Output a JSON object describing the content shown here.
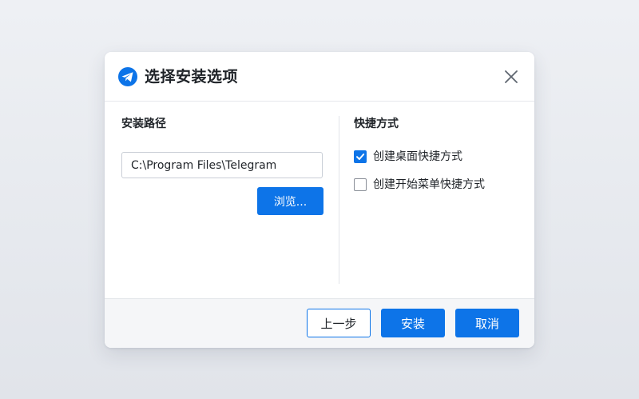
{
  "dialog": {
    "title": "选择安装选项",
    "logo_icon": "telegram-logo-icon",
    "close_icon": "close-icon"
  },
  "install_path": {
    "label": "安装路径",
    "value": "C:\\Program Files\\Telegram",
    "browse_label": "浏览..."
  },
  "shortcuts": {
    "label": "快捷方式",
    "options": [
      {
        "label": "创建桌面快捷方式",
        "checked": true
      },
      {
        "label": "创建开始菜单快捷方式",
        "checked": false
      }
    ]
  },
  "footer": {
    "back_label": "上一步",
    "install_label": "安装",
    "cancel_label": "取消"
  },
  "colors": {
    "accent": "#0d74e8",
    "background": "#e6e9ee",
    "dialog": "#ffffff",
    "footer": "#f5f6f8"
  }
}
